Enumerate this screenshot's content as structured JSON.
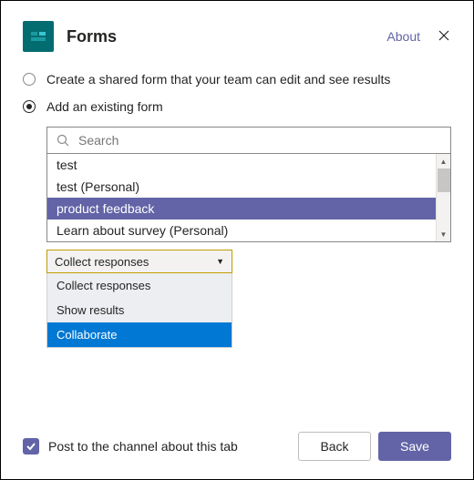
{
  "header": {
    "title": "Forms",
    "about": "About"
  },
  "options": {
    "create_label": "Create a shared form that your team can edit and see results",
    "add_label": "Add an existing form"
  },
  "search": {
    "placeholder": "Search",
    "items": [
      "test",
      "test (Personal)",
      "product feedback",
      "Learn about survey (Personal)"
    ],
    "selected_index": 2
  },
  "action_select": {
    "value": "Collect responses",
    "options": [
      "Collect responses",
      "Show results",
      "Collaborate"
    ],
    "highlight_index": 2
  },
  "footer": {
    "post_label": "Post to the channel about this tab",
    "back": "Back",
    "save": "Save"
  },
  "colors": {
    "accent": "#6264a7",
    "blue_highlight": "#0078d4",
    "forms_icon_bg": "#036c70"
  }
}
